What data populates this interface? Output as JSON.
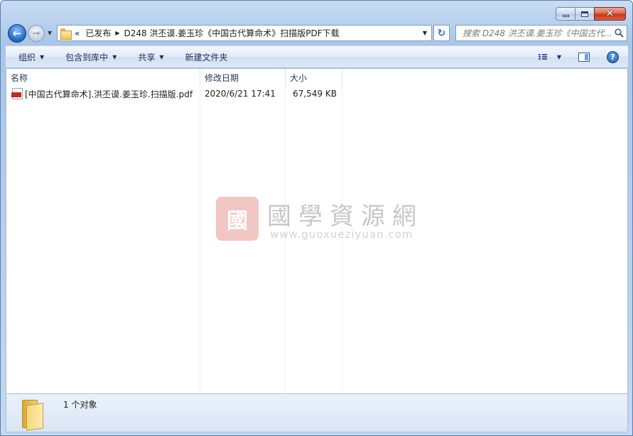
{
  "window": {
    "minimize_icon": "minimize-icon",
    "maximize_icon": "maximize-icon",
    "close_glyph": "✕"
  },
  "nav": {
    "back_glyph": "←",
    "forward_glyph": "→",
    "recent_glyph": "▼"
  },
  "address": {
    "overflow_glyph": "«",
    "crumbs": [
      "已发布",
      "D248 洪丕谟.姜玉珍《中国古代算命术》扫描版PDF下载"
    ],
    "separator": "▶",
    "dropdown_glyph": "▼"
  },
  "refresh": {
    "glyph": "↻"
  },
  "search": {
    "placeholder": "搜索 D248 洪丕谟.姜玉珍《中国古代..."
  },
  "toolbar": {
    "items": [
      {
        "label": "组织",
        "has_arrow": true
      },
      {
        "label": "包含到库中",
        "has_arrow": true
      },
      {
        "label": "共享",
        "has_arrow": true
      },
      {
        "label": "新建文件夹",
        "has_arrow": false
      }
    ],
    "arrow_glyph": "▼",
    "help_glyph": "?"
  },
  "columns": {
    "name": "名称",
    "modified": "修改日期",
    "size": "大小"
  },
  "files": [
    {
      "icon": "pdf-icon",
      "name": "[中国古代算命术].洪丕谟.姜玉珍.扫描版.pdf",
      "modified": "2020/6/21 17:41",
      "size": "67,549 KB"
    }
  ],
  "watermark": {
    "seal_char": "國",
    "title": "國學資源網",
    "url": "www.guoxueziyuan.com",
    "seal_color": "#e79a93"
  },
  "details": {
    "count_text": "1 个对象"
  },
  "colors": {
    "accent": "#2a70c9",
    "close_red": "#c4361b",
    "pdf_red": "#c52a1f",
    "folder_yellow": "#f1cf72"
  }
}
